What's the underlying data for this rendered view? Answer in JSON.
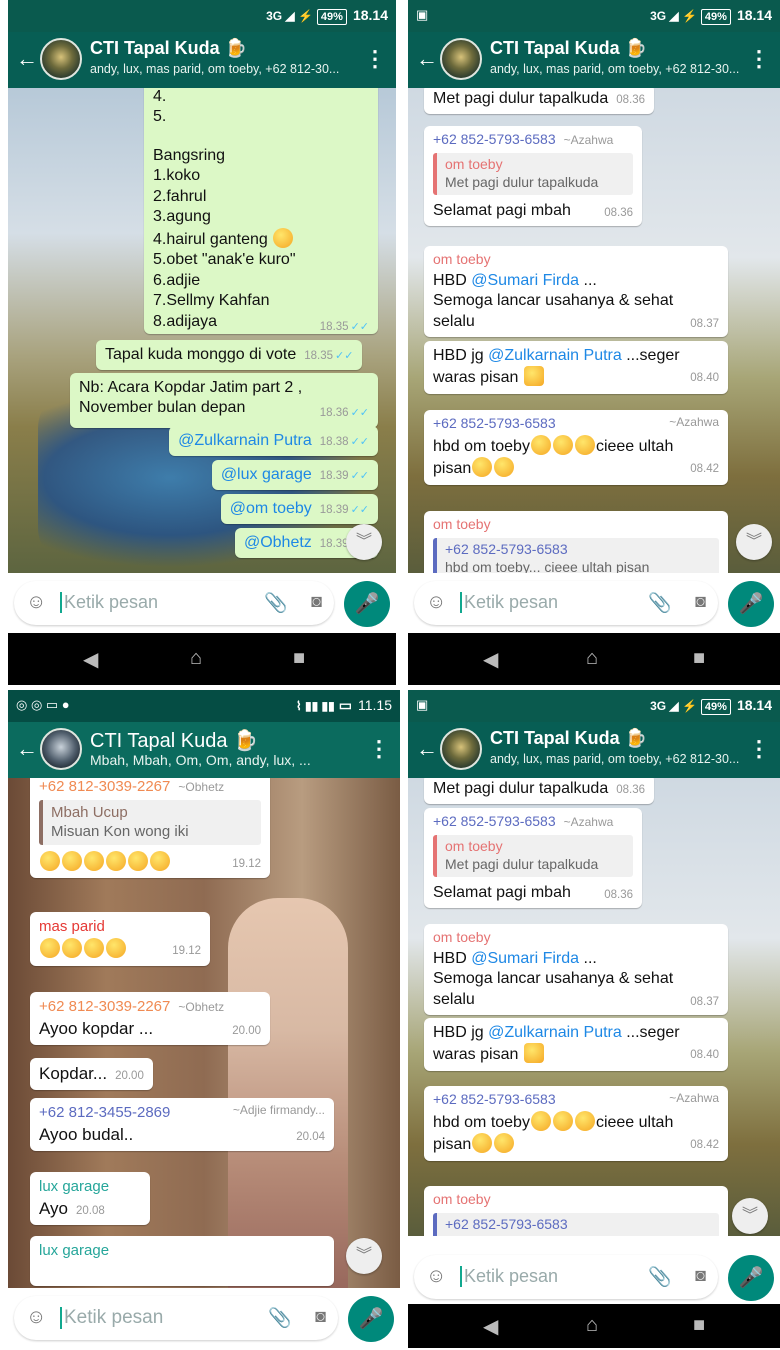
{
  "group_title": "CTI Tapal Kuda",
  "panels": {
    "tl": {
      "time": "18.14",
      "battery": "49%",
      "subtitle": "andy, lux, mas parid, om toeby, +62 812-30..."
    },
    "tr": {
      "time": "18.14",
      "battery": "49%",
      "subtitle": "andy, lux, mas parid, om toeby, +62 812-30..."
    },
    "bl": {
      "time": "11.15",
      "subtitle": "Mbah, Mbah, Om, Om, andy, lux, ..."
    },
    "br": {
      "time": "18.14",
      "battery": "49%",
      "subtitle": "andy, lux, mas parid, om toeby, +62 812-30..."
    }
  },
  "input_placeholder": "Ketik pesan",
  "icons": {
    "back": "arrow-left-icon",
    "menu": "more-vert-icon",
    "emoji": "emoji-icon",
    "attach": "paperclip-icon",
    "camera": "camera-icon",
    "mic": "mic-icon"
  },
  "colors": {
    "appbar": "#075e54",
    "out_bubble": "#dcf8c6",
    "mic": "#00897b"
  },
  "tl_chat": {
    "list_tail": [
      "4.",
      "5."
    ],
    "group": "Bangsring",
    "names": [
      "1.koko",
      "2.fahrul",
      "3.agung",
      "4.hairul ganteng",
      "5.obet \"anak'e kuro\"",
      "6.adjie",
      "7.Sellmy Kahfan",
      "8.adijaya"
    ],
    "list_time": "18.35",
    "m1": "Tapal kuda monggo di vote",
    "m1_time": "18.35",
    "m2a": "Nb: Acara Kopdar Jatim part 2 ,",
    "m2b": "November bulan depan",
    "m2_time": "18.36",
    "tags": [
      {
        "t": "@Zulkarnain Putra",
        "time": "18.38"
      },
      {
        "t": "@lux garage",
        "time": "18.39"
      },
      {
        "t": "@om toeby",
        "time": "18.39"
      },
      {
        "t": "@Obhetz",
        "time": "18.39"
      }
    ]
  },
  "right_chat": {
    "m1": "Met pagi dulur tapalkuda",
    "m1_time": "08.36",
    "m2_sender": "+62 852-5793-6583",
    "m2_nick": "~Azahwa",
    "m2_quote_name": "om toeby",
    "m2_quote_text": "Met pagi dulur tapalkuda",
    "m2_text": "Selamat pagi mbah",
    "m2_time": "08.36",
    "m3_sender": "om toeby",
    "m3_hbd": "HBD",
    "m3_mention": "@Sumari Firda",
    "m3_after": " ...",
    "m3_l2": "Semoga lancar usahanya & sehat",
    "m3_l3": "selalu",
    "m3_time": "08.37",
    "m4_pre": "HBD jg ",
    "m4_mention": "@Zulkarnain Putra",
    "m4_post": " ...seger",
    "m4_l2": "waras pisan",
    "m4_time": "08.40",
    "m5_sender": "+62 852-5793-6583",
    "m5_nick": "~Azahwa",
    "m5_l1": "hbd om toeby",
    "m5_l1b": "cieee ultah",
    "m5_l2": "pisan",
    "m5_time": "08.42",
    "m6_sender": "om toeby",
    "m6_quote": "+62 852-5793-6583",
    "m6_cut": "hbd om toeby... cieee ultah pisan"
  },
  "bl_chat": {
    "m1_sender": "+62 812-3039-2267",
    "m1_nick": "~Obhetz",
    "m1_quote_name": "Mbah Ucup",
    "m1_quote_text": "Misuan Kon wong iki",
    "m1_time": "19.12",
    "m2_sender": "mas parid",
    "m2_time": "19.12",
    "m3_sender": "+62 812-3039-2267",
    "m3_nick": "~Obhetz",
    "m3_text": "Ayoo kopdar ...",
    "m3_time": "20.00",
    "m4_text": "Kopdar...",
    "m4_time": "20.00",
    "m5_sender": "+62 812-3455-2869",
    "m5_nick": "~Adjie firmandy...",
    "m5_text": "Ayoo budal..",
    "m5_time": "20.04",
    "m6_sender": "lux garage",
    "m6_text": "Ayo",
    "m6_time": "20.08",
    "m7_sender": "lux garage"
  }
}
